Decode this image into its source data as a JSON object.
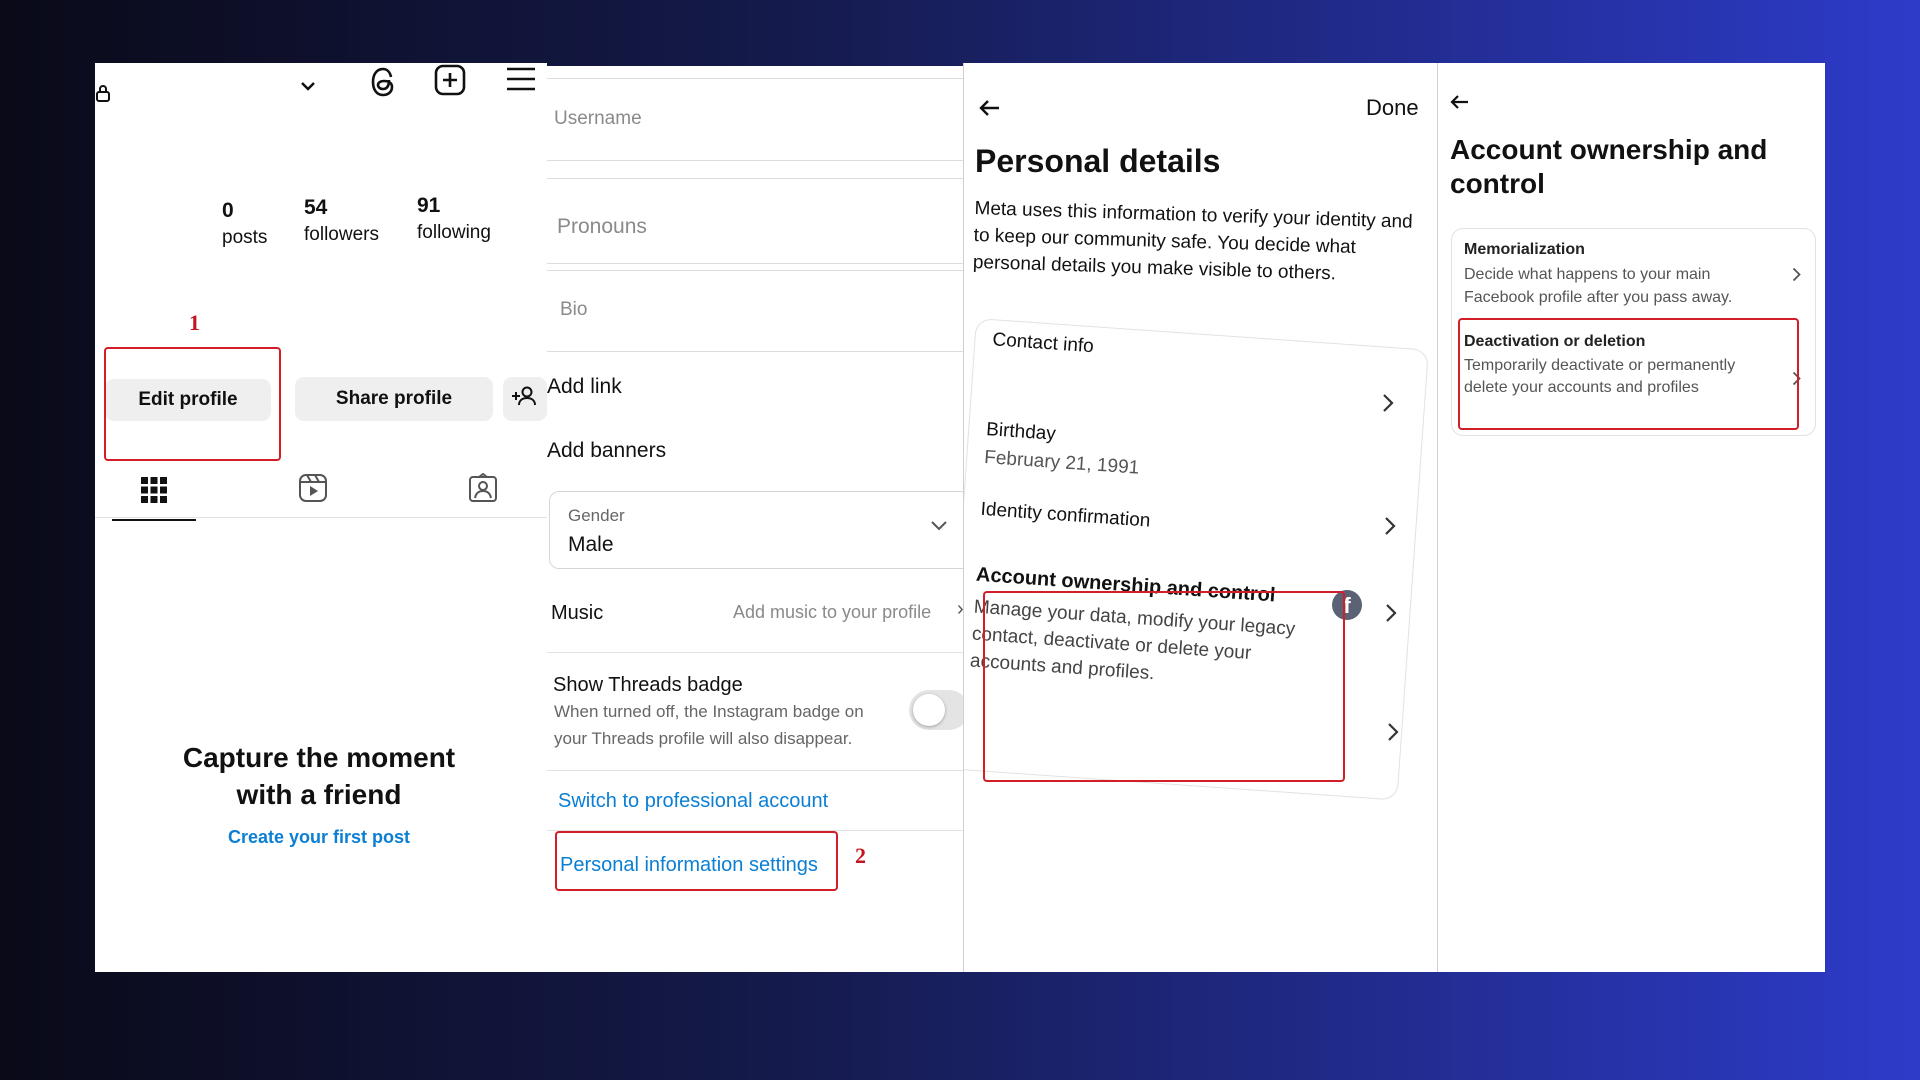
{
  "panel1": {
    "header": {
      "lock_icon": "lock-icon",
      "chevron_icon": "chevron-down-icon",
      "threads_icon": "threads-icon",
      "add_icon": "plus-square-icon",
      "menu_icon": "hamburger-menu-icon"
    },
    "stats": [
      {
        "value": "0",
        "label": "posts"
      },
      {
        "value": "54",
        "label": "followers"
      },
      {
        "value": "91",
        "label": "following"
      }
    ],
    "step_number": "1",
    "edit_profile": "Edit profile",
    "share_profile": "Share profile",
    "empty_title_line1": "Capture the moment",
    "empty_title_line2": "with a friend",
    "create_first_post": "Create your first post"
  },
  "panel2": {
    "username_placeholder": "Username",
    "pronouns_placeholder": "Pronouns",
    "bio_placeholder": "Bio",
    "add_link": "Add link",
    "add_banners": "Add banners",
    "gender_label": "Gender",
    "gender_value": "Male",
    "music_label": "Music",
    "music_value": "Add music to your profile",
    "threads_badge_title": "Show Threads badge",
    "threads_badge_desc_line1": "When turned off, the Instagram badge on",
    "threads_badge_desc_line2": "your Threads profile will also disappear.",
    "switch_professional": "Switch to professional account",
    "personal_info_settings": "Personal information settings",
    "step_number": "2"
  },
  "panel3": {
    "done": "Done",
    "title": "Personal details",
    "description": "Meta uses this information to verify your identity and to keep our community safe. You decide what personal details you make visible to others.",
    "contact_info": "Contact info",
    "birthday_label": "Birthday",
    "birthday_value": "February 21, 1991",
    "identity_confirmation": "Identity confirmation",
    "account_ownership_title": "Account ownership and control",
    "account_ownership_desc": "Manage your data, modify your legacy contact, deactivate or delete your accounts and profiles."
  },
  "panel4": {
    "title_line1": "Account ownership and",
    "title_line2": "control",
    "memorialization_title": "Memorialization",
    "memorialization_desc": "Decide what happens to your main Facebook profile after you pass away.",
    "deactivation_title": "Deactivation or deletion",
    "deactivation_desc": "Temporarily deactivate or permanently delete your accounts and profiles"
  },
  "colors": {
    "accent_red": "#d11f2a",
    "link_blue": "#0a7fd4"
  }
}
